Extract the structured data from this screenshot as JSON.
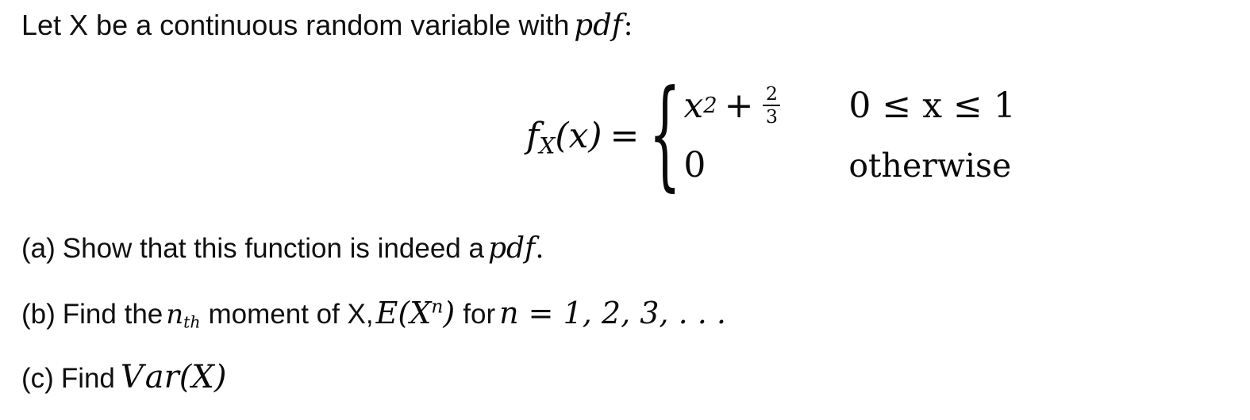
{
  "document": {
    "background_color": "#ffffff",
    "text_color": "#101010"
  },
  "intro": {
    "text_before": "Let X be a continuous random variable with",
    "pdf_term": "pdf",
    "colon": ":"
  },
  "formula": {
    "function_name": "f",
    "function_subscript": "X",
    "function_arg": "(x)",
    "equals": "=",
    "brace": "{",
    "cases": [
      {
        "expression_base": "x",
        "expression_exponent": "2",
        "operator": "+",
        "fraction_numerator": "2",
        "fraction_denominator": "3",
        "condition": "0 ≤ x ≤ 1",
        "condition_style": "math"
      },
      {
        "expression_base": "0",
        "expression_exponent": "",
        "operator": "",
        "fraction_numerator": "",
        "fraction_denominator": "",
        "condition": "otherwise",
        "condition_style": "upright"
      }
    ]
  },
  "parts": {
    "a": {
      "label": "(a)",
      "text_before": "Show that this function is indeed a",
      "math_term": "pdf",
      "text_after": "."
    },
    "b": {
      "label": "(b)",
      "text_before": "Find the",
      "math_nth_base": "n",
      "math_nth_sub": "th",
      "text_middle": "moment of X,",
      "math_expectation": "E(X",
      "math_expectation_exp": "n",
      "math_expectation_close": ")",
      "text_for": "for",
      "math_n_values": "n = 1, 2, 3, . . ."
    },
    "c": {
      "label": "(c)",
      "text_before": "Find",
      "math_var": "V",
      "math_var_ar": "ar",
      "math_var_arg": "(X)"
    }
  }
}
